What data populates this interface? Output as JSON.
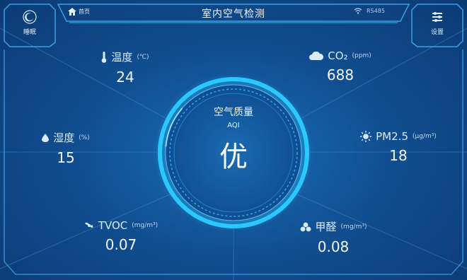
{
  "header": {
    "home_label": "首页",
    "title": "室内空气检测",
    "rs485_label": "RS485"
  },
  "sidebar": {
    "left_label": "睡眠",
    "right_label": "设置"
  },
  "metrics": {
    "temperature": {
      "label": "温度",
      "unit": "(℃)",
      "value": "24"
    },
    "humidity": {
      "label": "湿度",
      "unit": "(%)",
      "value": "15"
    },
    "tvoc": {
      "label": "TVOC",
      "unit": "(mg/m³)",
      "value": "0.07"
    },
    "co2": {
      "label": "CO₂",
      "unit": "(ppm)",
      "value": "688"
    },
    "pm25": {
      "label": "PM2.5",
      "unit": "(μg/m³)",
      "value": "18"
    },
    "formaldehyde": {
      "label": "甲醛",
      "unit": "(mg/m³)",
      "value": "0.08"
    }
  },
  "center": {
    "label": "空气质量",
    "sub": "AQI",
    "grade": "优"
  },
  "icons": {
    "home": "home-icon",
    "wifi": "wifi-icon",
    "sleep": "moon-icon",
    "settings": "settings-icon",
    "temperature": "thermometer-icon",
    "humidity": "droplet-icon",
    "tvoc": "fan-icon",
    "co2": "cloud-icon",
    "pm25": "sun-icon",
    "formaldehyde": "molecule-icon"
  },
  "colors": {
    "background": "#0d3f7a",
    "ring": "#29c5ff",
    "text": "#ffffff"
  }
}
